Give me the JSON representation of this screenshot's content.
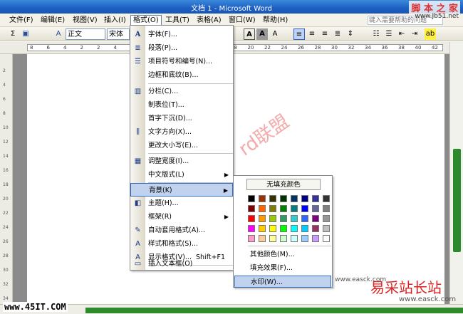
{
  "window": {
    "title": "文档 1 - Microsoft Word"
  },
  "watermarks": {
    "top_right": "脚 本 之 家",
    "top_right_url": "www.Jb51.net",
    "bottom_left": "www.45IT.COM",
    "center": "rd联盟",
    "bottom_right": "易采站长站",
    "bottom_right_url": "www.easck.com",
    "middle": "www.easck.com"
  },
  "menubar": {
    "items": [
      "文件(F)",
      "编辑(E)",
      "视图(V)",
      "插入(I)",
      "格式(O)",
      "工具(T)",
      "表格(A)",
      "窗口(W)",
      "帮助(H)"
    ],
    "help_placeholder": "键入需要帮助的问题"
  },
  "toolbar": {
    "style_value": "正文",
    "font_value": "宋体"
  },
  "ruler": {
    "ticks": [
      "8",
      "6",
      "4",
      "2",
      "2",
      "4",
      "6",
      "8",
      "10",
      "12",
      "14",
      "16",
      "18",
      "20",
      "22",
      "24",
      "26",
      "28",
      "30",
      "32",
      "34",
      "36",
      "38",
      "40",
      "42"
    ]
  },
  "vruler": [
    "2",
    "4",
    "6",
    "8",
    "10",
    "12",
    "14",
    "16",
    "18",
    "20",
    "22",
    "24",
    "26",
    "28",
    "30",
    "32",
    "34"
  ],
  "format_menu": {
    "items": [
      {
        "label": "字体(F)...",
        "icon": "font-A-icon"
      },
      {
        "label": "段落(P)...",
        "icon": "paragraph-icon"
      },
      {
        "label": "项目符号和编号(N)...",
        "icon": "bullets-icon"
      },
      {
        "label": "边框和底纹(B)...",
        "icon": ""
      },
      {
        "label": "分栏(C)...",
        "icon": "columns-icon"
      },
      {
        "label": "制表位(T)...",
        "icon": ""
      },
      {
        "label": "首字下沉(D)...",
        "icon": ""
      },
      {
        "label": "文字方向(X)...",
        "icon": "text-direction-icon"
      },
      {
        "label": "更改大小写(E)...",
        "icon": ""
      },
      {
        "label": "调整宽度(I)...",
        "icon": "adjust-width-icon"
      },
      {
        "label": "中文版式(L)",
        "icon": ""
      },
      {
        "label": "背景(K)",
        "icon": ""
      },
      {
        "label": "主题(H)...",
        "icon": "theme-icon"
      },
      {
        "label": "框架(R)",
        "icon": ""
      },
      {
        "label": "自动套用格式(A)...",
        "icon": "autoformat-icon"
      },
      {
        "label": "样式和格式(S)...",
        "icon": "styles-icon"
      },
      {
        "label": "显示格式(V)...",
        "icon": "reveal-format-icon"
      },
      {
        "label": "插入文本框(O)",
        "icon": "textbox-icon"
      }
    ],
    "reveal_shortcut": "Shift+F1"
  },
  "background_submenu": {
    "no_fill": "无填充颜色",
    "more_colors": "其他颜色(M)...",
    "fill_effects": "填充效果(F)...",
    "watermark": "水印(W)...",
    "colors": [
      [
        "#000000",
        "#993300",
        "#333300",
        "#003300",
        "#003366",
        "#000080",
        "#333399",
        "#333333"
      ],
      [
        "#800000",
        "#ff6600",
        "#808000",
        "#008000",
        "#008080",
        "#0000ff",
        "#666699",
        "#808080"
      ],
      [
        "#ff0000",
        "#ff9900",
        "#99cc00",
        "#339966",
        "#33cccc",
        "#3366ff",
        "#800080",
        "#969696"
      ],
      [
        "#ff00ff",
        "#ffcc00",
        "#ffff00",
        "#00ff00",
        "#00ffff",
        "#00ccff",
        "#993366",
        "#c0c0c0"
      ],
      [
        "#ff99cc",
        "#ffcc99",
        "#ffff99",
        "#ccffcc",
        "#ccffff",
        "#99ccff",
        "#cc99ff",
        "#ffffff"
      ]
    ]
  }
}
